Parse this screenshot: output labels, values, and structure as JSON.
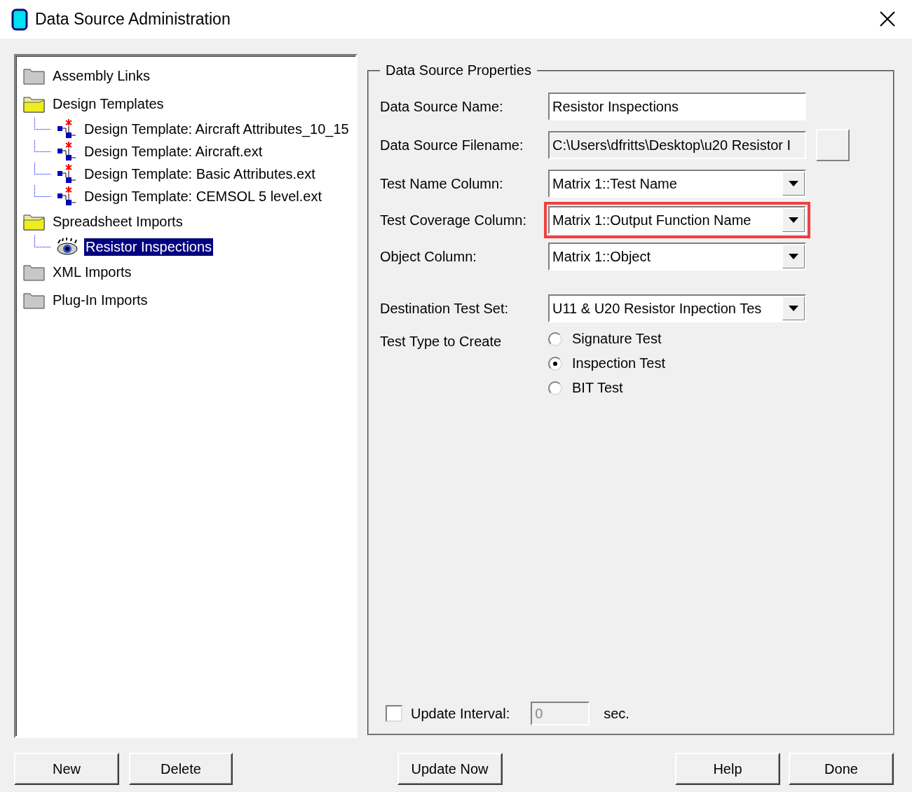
{
  "window": {
    "title": "Data Source Administration"
  },
  "tree": [
    {
      "label": "Assembly Links",
      "kind": "folder",
      "expanded": false,
      "selected": false
    },
    {
      "label": "Design Templates",
      "kind": "folder",
      "expanded": true,
      "selected": false,
      "children": [
        {
          "label": "Design Template: Aircraft Attributes_10_15",
          "kind": "template",
          "selected": false
        },
        {
          "label": "Design Template: Aircraft.ext",
          "kind": "template",
          "selected": false
        },
        {
          "label": "Design Template: Basic Attributes.ext",
          "kind": "template",
          "selected": false
        },
        {
          "label": "Design Template: CEMSOL 5 level.ext",
          "kind": "template",
          "selected": false
        }
      ]
    },
    {
      "label": "Spreadsheet Imports",
      "kind": "folder",
      "expanded": true,
      "selected": false,
      "children": [
        {
          "label": "Resistor Inspections",
          "kind": "spreadsheet",
          "selected": true
        }
      ]
    },
    {
      "label": "XML Imports",
      "kind": "folder",
      "expanded": false,
      "selected": false
    },
    {
      "label": "Plug-In Imports",
      "kind": "folder",
      "expanded": false,
      "selected": false
    }
  ],
  "properties": {
    "title": "Data Source Properties",
    "fields": [
      {
        "label": "Data Source Name:",
        "kind": "text",
        "value": "Resistor Inspections",
        "highlighted": false
      },
      {
        "label": "Data Source Filename:",
        "kind": "path",
        "value": "C:\\Users\\dfritts\\Desktop\\u20 Resistor I",
        "highlighted": false
      },
      {
        "label": "Test Name Column:",
        "kind": "combo",
        "value": "Matrix 1::Test Name",
        "highlighted": false
      },
      {
        "label": "Test Coverage Column:",
        "kind": "combo",
        "value": "Matrix 1::Output Function Name",
        "highlighted": true
      },
      {
        "label": "Object Column:",
        "kind": "combo",
        "value": "Matrix 1::Object",
        "highlighted": false
      },
      {
        "label": "Destination Test Set:",
        "kind": "combo",
        "value": "U11 & U20 Resistor Inpection Tes",
        "highlighted": false
      }
    ],
    "test_type": {
      "label": "Test Type to Create",
      "options": [
        {
          "label": "Signature Test",
          "selected": false
        },
        {
          "label": "Inspection Test",
          "selected": true
        },
        {
          "label": "BIT Test",
          "selected": false
        }
      ]
    },
    "update_interval": {
      "label": "Update Interval:",
      "checked": false,
      "value": "0",
      "disabled": true,
      "unit": "sec."
    }
  },
  "buttons": {
    "left": [
      "New",
      "Delete"
    ],
    "middle": [
      "Update Now"
    ],
    "right": [
      "Help",
      "Done"
    ]
  }
}
